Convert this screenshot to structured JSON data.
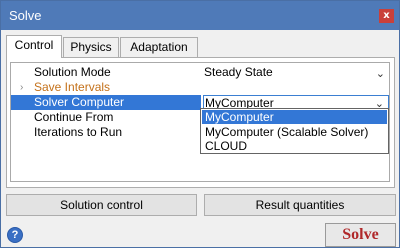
{
  "window": {
    "title": "Solve",
    "close_glyph": "x"
  },
  "tabs": [
    {
      "label": "Control",
      "active": true
    },
    {
      "label": "Physics",
      "active": false
    },
    {
      "label": "Adaptation",
      "active": false
    }
  ],
  "properties": [
    {
      "name": "Solution Mode",
      "value": "Steady State"
    },
    {
      "name": "Save Intervals",
      "value": "",
      "expander": "›",
      "color": "#c4711a"
    },
    {
      "name": "Solver Computer",
      "value": "MyComputer",
      "selected": true
    },
    {
      "name": "Continue From",
      "value": ""
    },
    {
      "name": "Iterations to Run",
      "value": ""
    }
  ],
  "dropdown": {
    "chevron": "⌄",
    "options": [
      "MyComputer",
      "MyComputer (Scalable Solver)",
      "CLOUD"
    ],
    "highlighted_index": 0
  },
  "buttons": {
    "solution_control": "Solution control",
    "result_quantities": "Result quantities",
    "solve": "Solve",
    "help": "?"
  },
  "colors": {
    "titlebar": "#4f7ab8",
    "selection": "#3377d6",
    "orange_label": "#c4711a",
    "solve_text": "#b0282a",
    "close": "#c9403a"
  },
  "icons": [
    "close-icon",
    "chevron-down-icon",
    "expand-arrow-icon",
    "help-icon"
  ]
}
